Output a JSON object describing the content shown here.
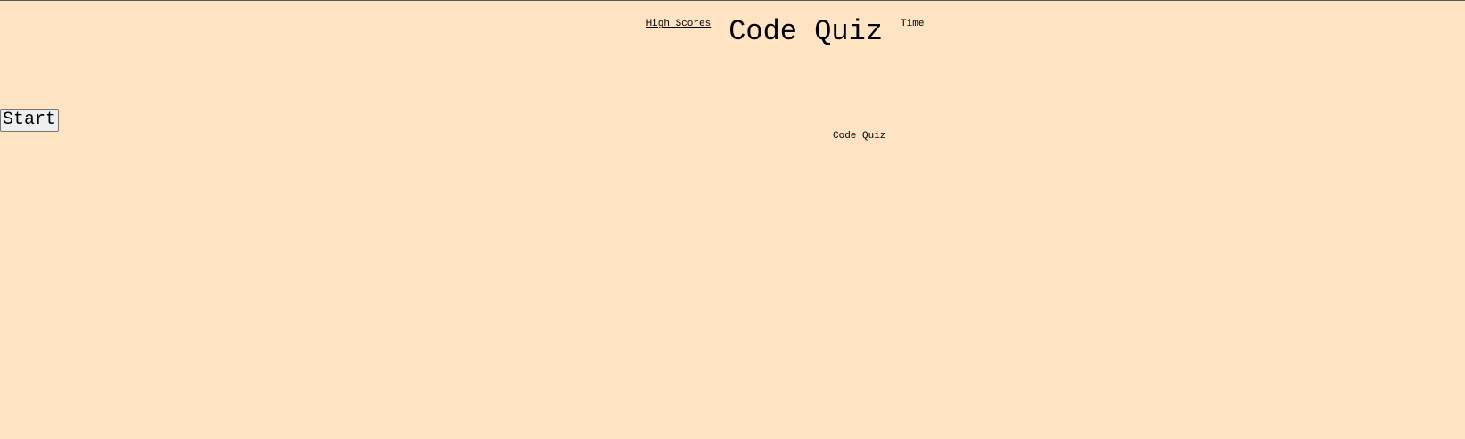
{
  "header": {
    "highscores_label": "High Scores",
    "title": "Code Quiz",
    "timer_label": "Time"
  },
  "main": {
    "start_label": "Start",
    "subtitle": "Code Quiz"
  },
  "colors": {
    "background": "#ffe4c4"
  }
}
